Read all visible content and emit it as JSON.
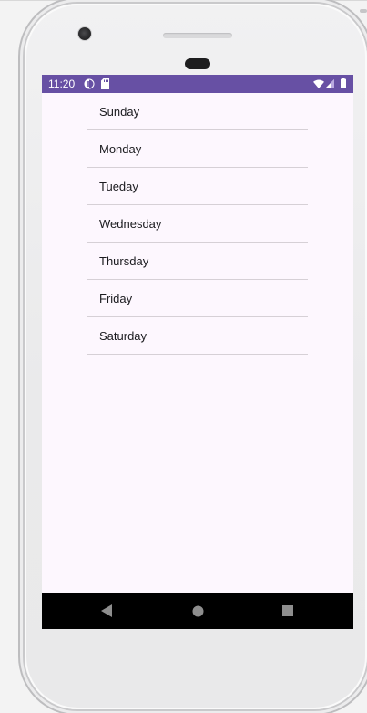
{
  "status_bar": {
    "time": "11:20",
    "background_color": "#6750a4",
    "left_icons": [
      "data-saver-icon",
      "sd-card-icon"
    ],
    "right_icons": [
      "wifi-icon",
      "cell-signal-icon",
      "battery-icon"
    ]
  },
  "list": {
    "items": [
      {
        "label": "Sunday"
      },
      {
        "label": "Monday"
      },
      {
        "label": "Tueday"
      },
      {
        "label": "Wednesday"
      },
      {
        "label": "Thursday"
      },
      {
        "label": "Friday"
      },
      {
        "label": "Saturday"
      }
    ]
  },
  "nav_bar": {
    "buttons": [
      "back-icon",
      "home-icon",
      "recents-icon"
    ]
  },
  "colors": {
    "screen_background": "#fdf7fe",
    "divider": "#d6d0d6",
    "nav_bar": "#000000",
    "nav_icons": "#8e8e8e"
  }
}
